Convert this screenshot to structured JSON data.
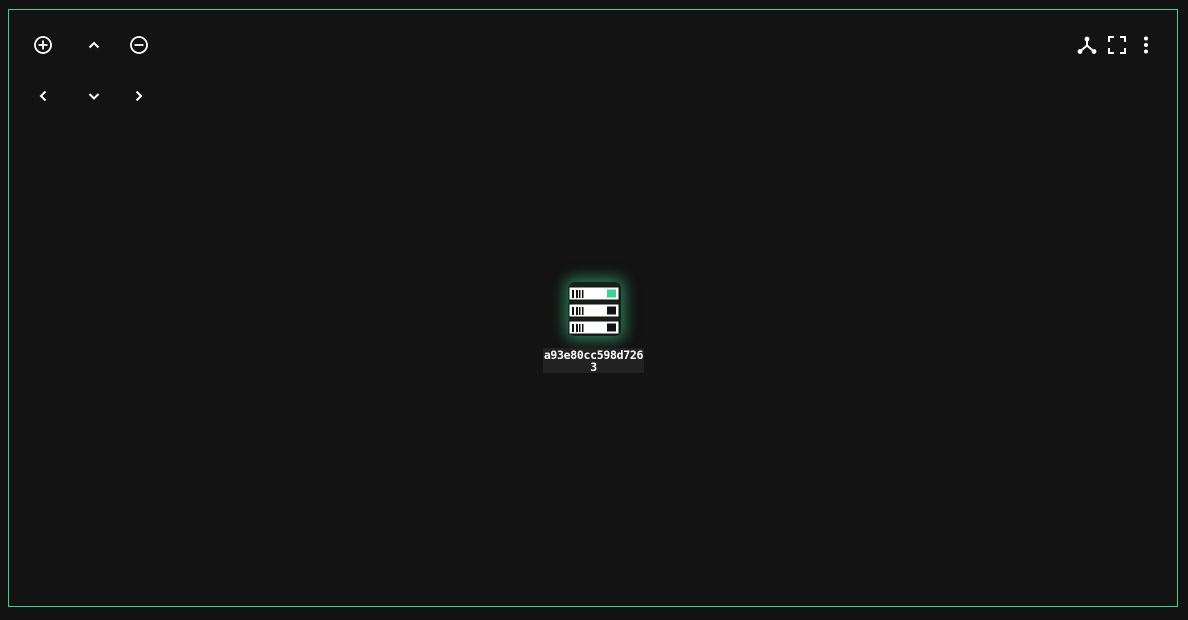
{
  "graph": {
    "node": {
      "id": "a93e80cc598d7263",
      "label": "a93e80cc598d7263",
      "icon": "server-icon",
      "status_color": "#3fcf8e"
    }
  },
  "controls": {
    "zoom_in": {
      "icon": "zoom-in-icon"
    },
    "pan_up": {
      "icon": "chevron-up-icon"
    },
    "zoom_out": {
      "icon": "zoom-out-icon"
    },
    "pan_left": {
      "icon": "chevron-left-icon"
    },
    "pan_down": {
      "icon": "chevron-down-icon"
    },
    "pan_right": {
      "icon": "chevron-right-icon"
    }
  },
  "toolbar": {
    "layout": {
      "icon": "graph-layout-icon"
    },
    "fullscreen": {
      "icon": "fullscreen-icon"
    },
    "more": {
      "icon": "more-vertical-icon"
    }
  },
  "colors": {
    "background": "#121212",
    "border_accent": "#3fcf8e",
    "icon": "#ffffff"
  }
}
